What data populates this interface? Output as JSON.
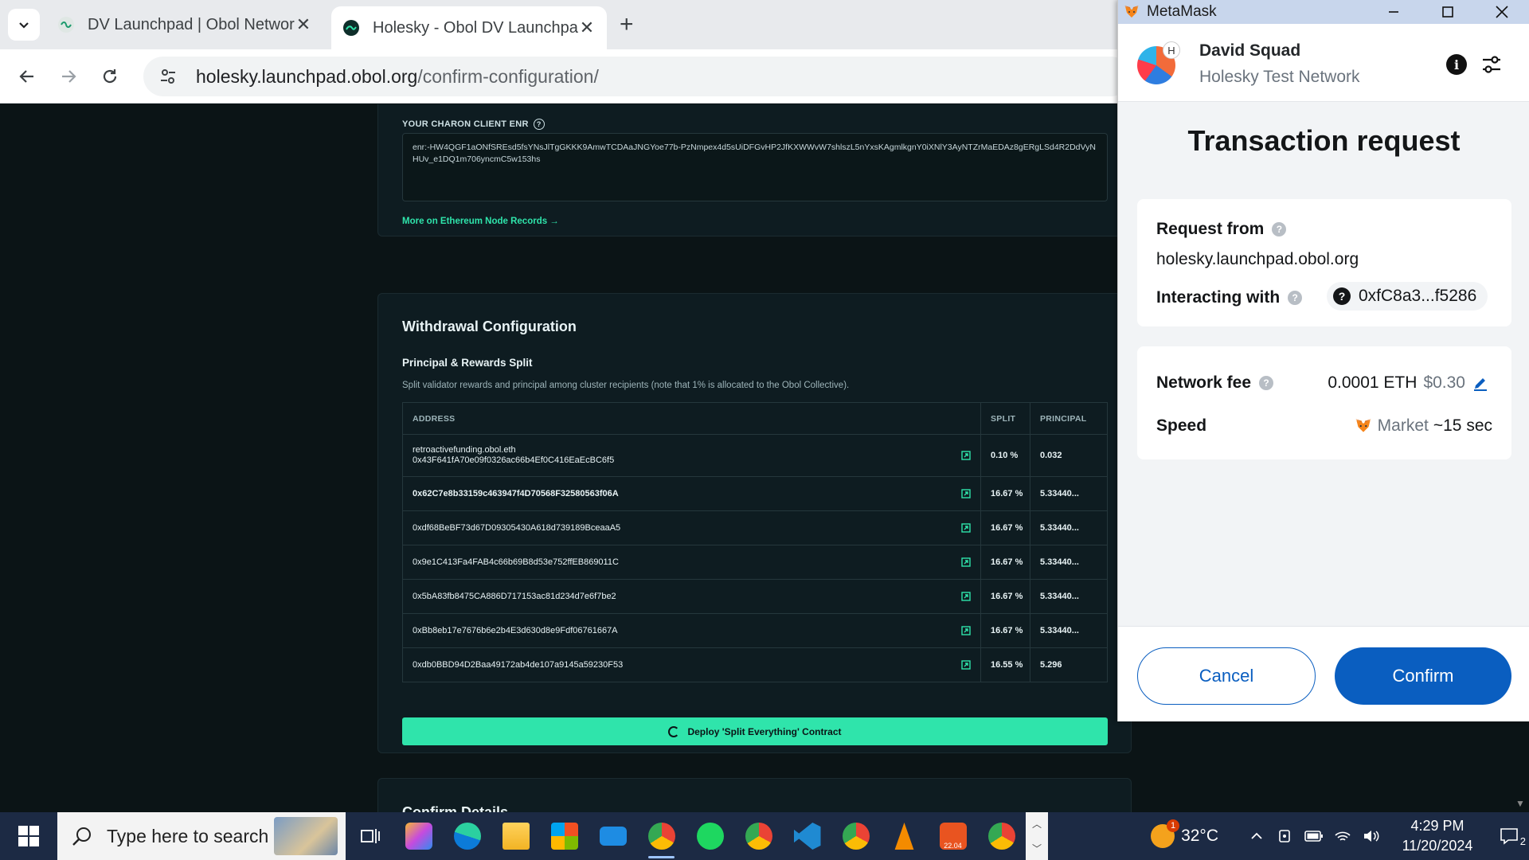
{
  "browser": {
    "tabs": [
      {
        "title": "DV Launchpad | Obol Network",
        "active": false
      },
      {
        "title": "Holesky - Obol DV Launchpad",
        "active": true
      }
    ],
    "url_host": "holesky.launchpad.obol.org",
    "url_path": "/confirm-configuration/"
  },
  "enr_section": {
    "label": "YOUR CHARON CLIENT ENR",
    "value": "enr:-HW4QGF1aONfSREsd5fsYNsJlTgGKKK9AmwTCDAaJNGYoe77b-PzNmpex4d5sUiDFGvHP2JfKXWWvW7shlszL5nYxsKAgmlkgnY0iXNlY3AyNTZrMaEDAz8gERgLSd4R2DdVyNHUv_e1DQ1m706yncmC5w153hs",
    "link": "More on Ethereum Node Records →"
  },
  "withdrawal": {
    "title": "Withdrawal Configuration",
    "subtitle": "Principal & Rewards Split",
    "description": "Split validator rewards and principal among cluster recipients (note that 1% is allocated to the Obol Collective).",
    "columns": [
      "ADDRESS",
      "SPLIT",
      "PRINCIPAL"
    ],
    "rows": [
      {
        "name": "retroactivefunding.obol.eth",
        "address": "0x43F641fA70e09f0326ac66b4Ef0C416EaEcBC6f5",
        "split": "0.10 %",
        "principal": "0.032"
      },
      {
        "name": "",
        "address": "0x62C7e8b33159c463947f4D70568F32580563f06A",
        "split": "16.67 %",
        "principal": "5.33440..."
      },
      {
        "name": "",
        "address": "0xdf68BeBF73d67D09305430A618d739189BceaaA5",
        "split": "16.67 %",
        "principal": "5.33440..."
      },
      {
        "name": "",
        "address": "0x9e1C413Fa4FAB4c66b69B8d53e752ffEB869011C",
        "split": "16.67 %",
        "principal": "5.33440..."
      },
      {
        "name": "",
        "address": "0x5bA83fb8475CA886D717153ac81d234d7e6f7be2",
        "split": "16.67 %",
        "principal": "5.33440..."
      },
      {
        "name": "",
        "address": "0xBb8eb17e7676b6e2b4E3d630d8e9Fdf06761667A",
        "split": "16.67 %",
        "principal": "5.33440..."
      },
      {
        "name": "",
        "address": "0xdb0BBD94D2Baa49172ab4de107a9145a59230F53",
        "split": "16.55 %",
        "principal": "5.296"
      }
    ],
    "deploy_label": "Deploy 'Split Everything' Contract"
  },
  "confirm_section": {
    "title": "Confirm Details"
  },
  "metamask": {
    "window_title": "MetaMask",
    "account_name": "David Squad",
    "avatar_badge": "H",
    "network": "Holesky Test Network",
    "heading": "Transaction request",
    "request_from_label": "Request from",
    "request_from_value": "holesky.launchpad.obol.org",
    "interacting_label": "Interacting with",
    "interacting_value": "0xfC8a3...f5286",
    "fee_label": "Network fee",
    "fee_eth": "0.0001 ETH",
    "fee_usd": "$0.30",
    "speed_label": "Speed",
    "speed_market": "Market",
    "speed_time": "~15 sec",
    "cancel_label": "Cancel",
    "confirm_label": "Confirm",
    "accent_color": "#0a5ec0"
  },
  "taskbar": {
    "search_placeholder": "Type here to search",
    "weather_temp": "32°C",
    "weather_badge": "1",
    "time": "4:29 PM",
    "date": "11/20/2024",
    "notification_count": "2",
    "ubuntu_badge": "22.04"
  }
}
